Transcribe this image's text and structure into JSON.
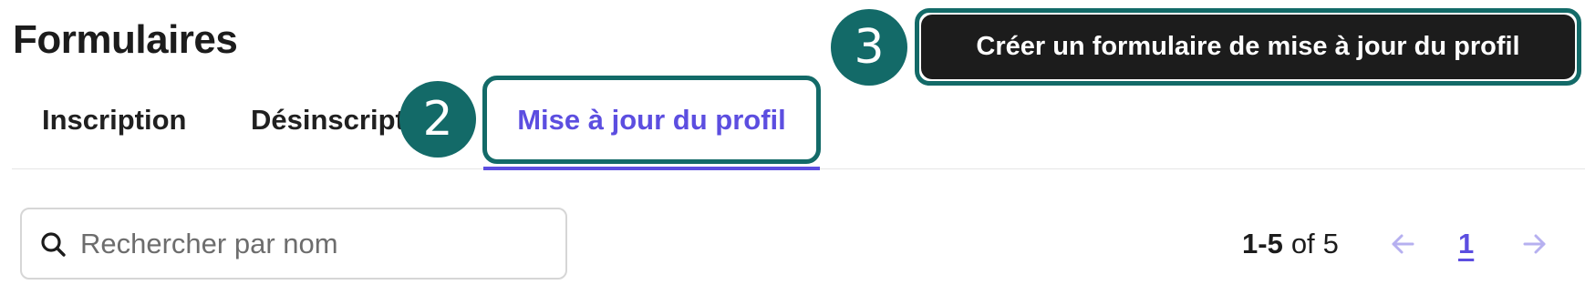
{
  "header": {
    "title": "Formulaires",
    "create_button_label": "Créer un formulaire de mise à jour du profil"
  },
  "annotations": {
    "marker_2": "2",
    "marker_3": "3"
  },
  "tabs": [
    {
      "label": "Inscription",
      "active": false
    },
    {
      "label": "Désinscription",
      "active": false
    },
    {
      "label": "Mise à jour du profil",
      "active": true
    }
  ],
  "search": {
    "placeholder": "Rechercher par nom",
    "value": ""
  },
  "pagination": {
    "range": "1-5",
    "of_label": "of",
    "total": "5",
    "current_page": "1",
    "prev_icon": "arrow-left-icon",
    "next_icon": "arrow-right-icon"
  },
  "colors": {
    "accent": "#5c4ee0",
    "annotation": "#136a68",
    "button_bg": "#1c1c1c",
    "arrow_disabled": "#b6b0f0"
  }
}
